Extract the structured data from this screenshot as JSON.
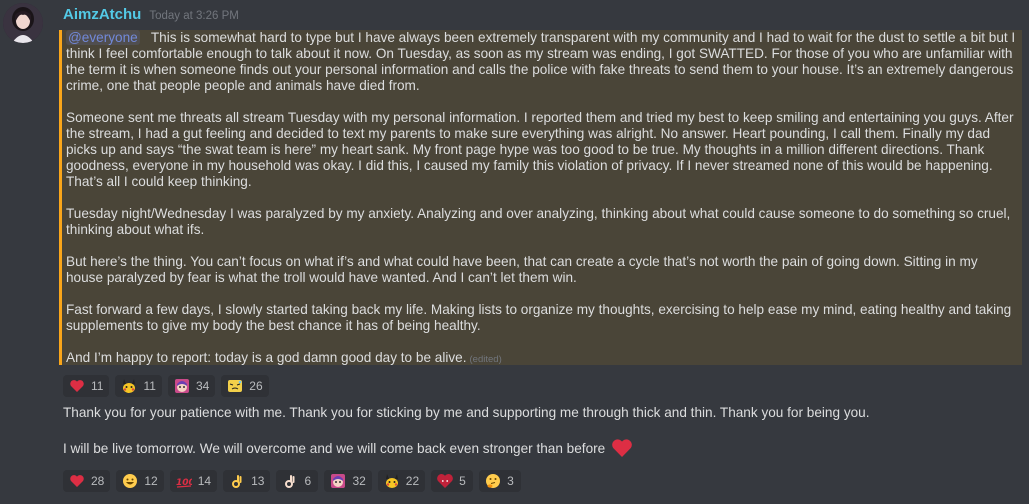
{
  "author": {
    "username": "AimzAtchu",
    "timestamp": "Today at 3:26 PM",
    "name_color": "#53c9e6"
  },
  "message1": {
    "mention": "@everyone",
    "paragraphs": [
      "This is somewhat hard to type but I have  always been extremely transparent with my community and I had to wait for the dust to settle a bit but I think I feel comfortable enough to talk about it now. On Tuesday, as soon as my stream was ending, I got SWATTED. For those of you who are unfamiliar with the term it is when someone finds out your personal information and calls the police with fake threats to send them to your house. It’s an extremely dangerous crime, one that people people and animals have died from.",
      "Someone sent me threats all stream Tuesday with my personal information. I reported them and tried my best to keep smiling and entertaining you guys. After the stream, I had a gut feeling and decided to text my parents to make sure everything was alright. No answer. Heart pounding, I call them. Finally my dad picks up and says “the swat team is here” my heart sank. My front page hype was too good to be true. My thoughts in a million different directions. Thank goodness, everyone in my household was okay. I did this, I caused my family this violation of privacy. If I never streamed none of this would be happening. That’s all I could keep thinking.",
      "Tuesday night/Wednesday I was paralyzed by my anxiety. Analyzing and over analyzing, thinking about what could cause someone to do something so cruel, thinking about what ifs.",
      "But here’s the thing. You can’t focus on what if’s and what could have been, that can create a cycle that’s not worth the pain of going down. Sitting in my house paralyzed by fear is what the troll would have wanted. And I can’t let them win.",
      "Fast forward a few days, I slowly started taking back my life. Making lists to organize my thoughts, exercising to help ease my mind, eating healthy and taking supplements to give my body the best chance it has of being healthy.",
      "And I’m happy to report: today is a god damn good day to be alive."
    ],
    "edited_label": "(edited)",
    "reactions": [
      {
        "icon": "heart",
        "count": "11"
      },
      {
        "icon": "pikachu",
        "count": "11"
      },
      {
        "icon": "anime-face",
        "count": "34"
      },
      {
        "icon": "pikachu-sweat",
        "count": "26"
      }
    ]
  },
  "message2": {
    "line1": "Thank you for your patience with me. Thank you for sticking by me and supporting me through thick and thin. Thank you for being you.",
    "line2": "I will be live tomorrow. We will overcome and we will come back even stronger than before",
    "reactions": [
      {
        "icon": "heart",
        "count": "28"
      },
      {
        "icon": "grin",
        "count": "12"
      },
      {
        "icon": "hundred",
        "count": "14"
      },
      {
        "icon": "ok-hand",
        "count": "13"
      },
      {
        "icon": "ok-hand-light",
        "count": "6"
      },
      {
        "icon": "anime-face",
        "count": "32"
      },
      {
        "icon": "pikachu",
        "count": "22"
      },
      {
        "icon": "red-heart-face",
        "count": "5"
      },
      {
        "icon": "thinking",
        "count": "3"
      }
    ]
  },
  "colors": {
    "background": "#36393f",
    "mention_highlight": "#4a4538",
    "mention_border": "#faa61a",
    "reaction_bg": "#2f3136"
  }
}
